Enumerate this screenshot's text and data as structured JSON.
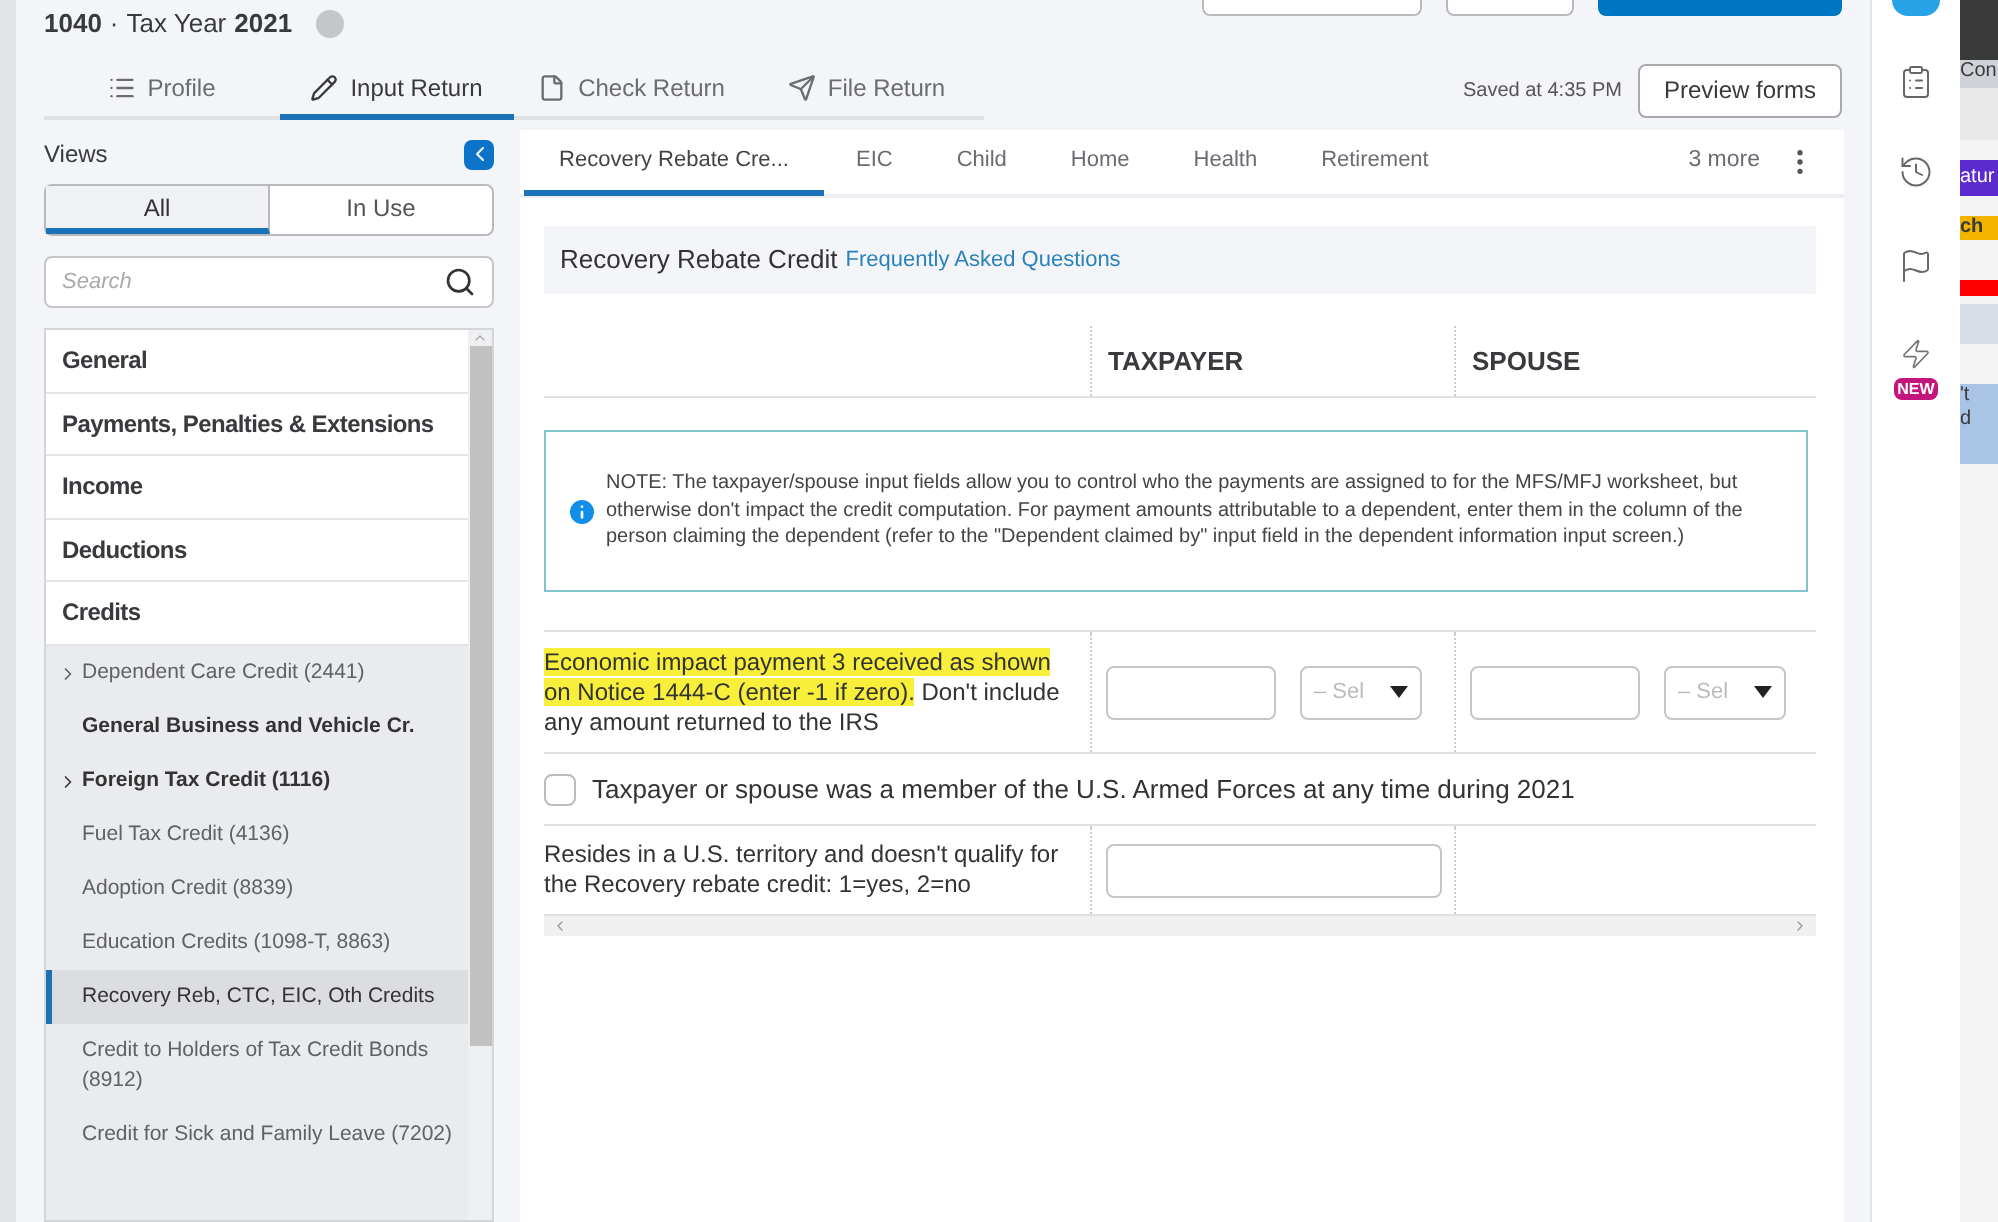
{
  "header": {
    "form": "1040",
    "separator": "·",
    "label": "Tax Year",
    "year": "2021"
  },
  "main_tabs": [
    {
      "label": "Profile",
      "selected": false
    },
    {
      "label": "Input Return",
      "selected": true
    },
    {
      "label": "Check Return",
      "selected": false
    },
    {
      "label": "File Return",
      "selected": false
    }
  ],
  "saved_status": "Saved at 4:35 PM",
  "preview_button": "Preview forms",
  "views": {
    "title": "Views",
    "toggle": [
      {
        "label": "All",
        "selected": true
      },
      {
        "label": "In Use",
        "selected": false
      }
    ],
    "search": {
      "placeholder": "Search"
    }
  },
  "nav_items": [
    {
      "kind": "category",
      "label": "General",
      "selected": false
    },
    {
      "kind": "category",
      "label": "Payments, Penalties & Extensions",
      "selected": false
    },
    {
      "kind": "category",
      "label": "Income",
      "selected": false
    },
    {
      "kind": "category",
      "label": "Deductions",
      "selected": false
    },
    {
      "kind": "category",
      "label": "Credits",
      "selected": false
    },
    {
      "kind": "item",
      "label": "Dependent Care Credit (2441)",
      "expandable": true,
      "bold": false,
      "selected": false
    },
    {
      "kind": "item",
      "label": "General Business and Vehicle Cr.",
      "expandable": false,
      "bold": true,
      "selected": false
    },
    {
      "kind": "item",
      "label": "Foreign Tax Credit (1116)",
      "expandable": true,
      "bold": true,
      "selected": false
    },
    {
      "kind": "item",
      "label": "Fuel Tax Credit (4136)",
      "expandable": false,
      "bold": false,
      "selected": false
    },
    {
      "kind": "item",
      "label": "Adoption Credit (8839)",
      "expandable": false,
      "bold": false,
      "selected": false
    },
    {
      "kind": "item",
      "label": "Education Credits (1098-T, 8863)",
      "expandable": false,
      "bold": false,
      "selected": false
    },
    {
      "kind": "item",
      "label": "Recovery Reb, CTC, EIC, Oth Credits",
      "expandable": false,
      "bold": false,
      "selected": true
    },
    {
      "kind": "item",
      "label": "Credit to Holders of Tax Credit Bonds (8912)",
      "expandable": false,
      "bold": false,
      "selected": false
    },
    {
      "kind": "item",
      "label": "Credit for Sick and Family Leave (7202)",
      "expandable": false,
      "bold": false,
      "selected": false
    }
  ],
  "sub_tabs": [
    {
      "label": "Recovery Rebate Cre...",
      "selected": true
    },
    {
      "label": "EIC",
      "selected": false
    },
    {
      "label": "Child",
      "selected": false
    },
    {
      "label": "Home",
      "selected": false
    },
    {
      "label": "Health",
      "selected": false
    },
    {
      "label": "Retirement",
      "selected": false
    }
  ],
  "more_tabs": "3 more",
  "section": {
    "title": "Recovery Rebate Credit",
    "link": "Frequently Asked Questions"
  },
  "columns": [
    "TAXPAYER",
    "SPOUSE"
  ],
  "note": "NOTE: The taxpayer/spouse input fields allow you to control who the payments are assigned to for the MFS/MFJ worksheet, but otherwise don't impact the credit computation. For payment amounts attributable to a dependent, enter them in the column of the person claiming the dependent (refer to the \"Dependent claimed by\" input field in the dependent information input screen.)",
  "rows": [
    {
      "kind": "amount",
      "label_parts": [
        {
          "text": "Economic impact payment 3 received as shown on Notice 1444-C (enter -1 if zero).",
          "highlighted": true
        },
        {
          "text": "Don't include any amount returned to the IRS",
          "highlighted": false
        }
      ],
      "selects": [
        {
          "placeholder": "– Sel"
        },
        {
          "placeholder": "– Sel"
        }
      ]
    },
    {
      "kind": "checkbox",
      "label": "Taxpayer or spouse was a member of the U.S. Armed Forces at any time during 2021",
      "checked": false
    },
    {
      "kind": "single_input",
      "label": "Resides in a U.S. territory and doesn't qualify for the Recovery rebate credit: 1=yes, 2=no"
    }
  ],
  "rail": {
    "badge": "NEW"
  },
  "background_window": [
    "Con",
    "atur",
    "ch",
    "'t",
    "d"
  ]
}
